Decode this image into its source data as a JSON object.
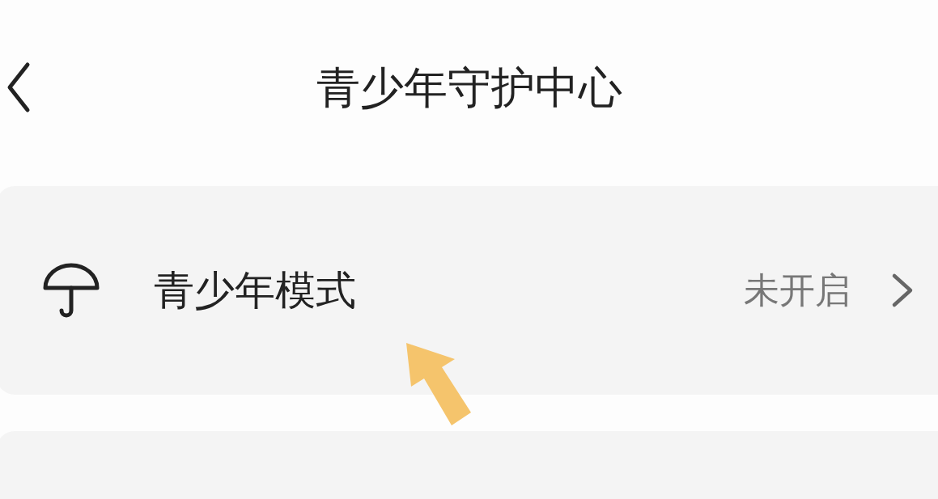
{
  "header": {
    "title": "青少年守护中心"
  },
  "settings": [
    {
      "label": "青少年模式",
      "status": "未开启"
    }
  ]
}
